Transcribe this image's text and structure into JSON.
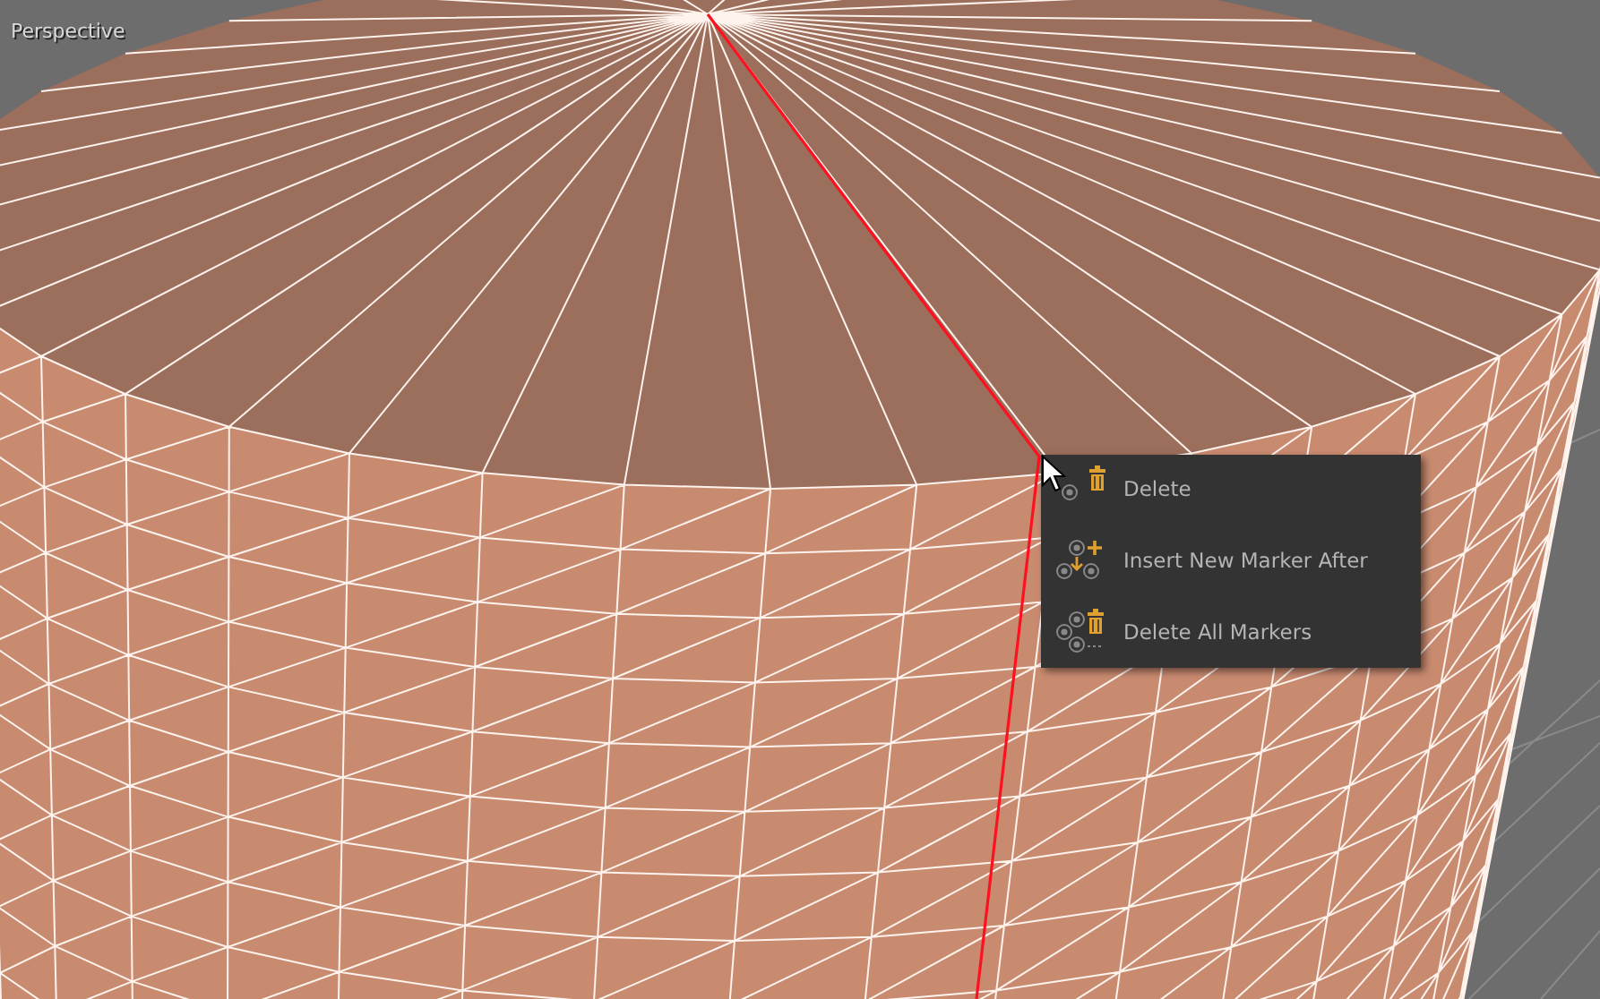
{
  "viewport": {
    "label": "Perspective"
  },
  "context_menu": {
    "items": [
      {
        "kind": "delete",
        "label": "Delete"
      },
      {
        "kind": "insert",
        "label": "Insert New Marker After"
      },
      {
        "kind": "delete_all",
        "label": "Delete All Markers"
      }
    ]
  }
}
